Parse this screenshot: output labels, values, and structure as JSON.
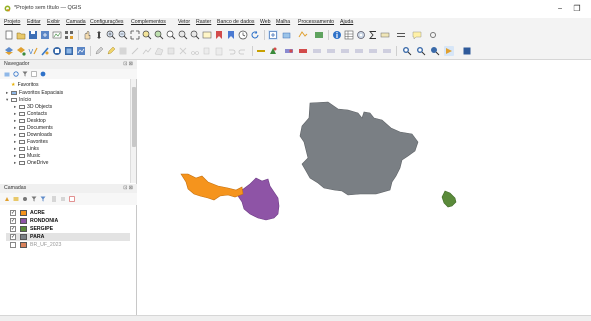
{
  "window": {
    "title": "*Projeto sem título — QGIS",
    "minimize": "−",
    "restore": "❐"
  },
  "menu": [
    "Projeto",
    "Editar",
    "Exibir",
    "Camada",
    "Configurações",
    "Complementos",
    "Vetor",
    "Raster",
    "Banco de dados",
    "Web",
    "Malha",
    "Processamento",
    "Ajuda"
  ],
  "browser": {
    "title": "Navegador",
    "header_icons": "⊡ ⊠",
    "items": [
      {
        "label": "Favoritos",
        "kind": "star"
      },
      {
        "label": "Favoritos Espaciais",
        "kind": "folder"
      },
      {
        "label": "Início",
        "kind": "folder-open"
      },
      {
        "label": "3D Objects",
        "kind": "folder"
      },
      {
        "label": "Contacts",
        "kind": "folder"
      },
      {
        "label": "Desktop",
        "kind": "folder"
      },
      {
        "label": "Documents",
        "kind": "folder"
      },
      {
        "label": "Downloads",
        "kind": "folder"
      },
      {
        "label": "Favorites",
        "kind": "folder"
      },
      {
        "label": "Links",
        "kind": "folder"
      },
      {
        "label": "Music",
        "kind": "folder"
      },
      {
        "label": "OneDrive",
        "kind": "folder"
      }
    ]
  },
  "layers": {
    "title": "Camadas",
    "header_icons": "⊡ ⊠",
    "items": [
      {
        "name": "ACRE",
        "color": "#f5941d",
        "checked": true,
        "selected": false,
        "dim": false
      },
      {
        "name": "RONDONIA",
        "color": "#8e54a6",
        "checked": true,
        "selected": false,
        "dim": false
      },
      {
        "name": "SERGIPE",
        "color": "#5a8a3a",
        "checked": true,
        "selected": false,
        "dim": false
      },
      {
        "name": "PARA",
        "color": "#7a7f84",
        "checked": true,
        "selected": true,
        "dim": false
      },
      {
        "name": "BR_UF_2023",
        "color": "#d9825b",
        "checked": false,
        "selected": false,
        "dim": true
      }
    ]
  },
  "map_features": {
    "para_color": "#7a7f84",
    "acre_color": "#f5941d",
    "rondonia_color": "#8e54a6",
    "sergipe_color": "#5a8a3a"
  }
}
